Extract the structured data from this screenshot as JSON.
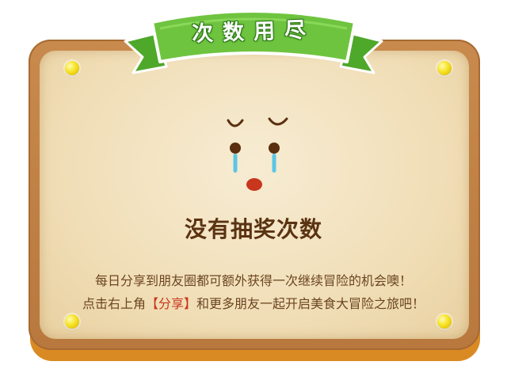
{
  "banner": {
    "title": "次数用尽"
  },
  "main": {
    "title": "没有抽奖次数",
    "line1": "每日分享到朋友圈都可额外获得一次继续冒险的机会噢！",
    "line2_prefix": "点击右上角",
    "line2_highlight": "【分享】",
    "line2_suffix": "和更多朋友一起开启美食大冒险之旅吧！"
  },
  "colors": {
    "ribbon": "#6fc43f",
    "board": "#b8783e",
    "paper": "#f0ddb5",
    "title_text": "#5a3312",
    "body_text": "#6b4520",
    "highlight": "#c8361d",
    "pin": "#f7e324"
  },
  "icons": {
    "face": "sad-crying-face-icon",
    "pins": "pin-icon"
  }
}
